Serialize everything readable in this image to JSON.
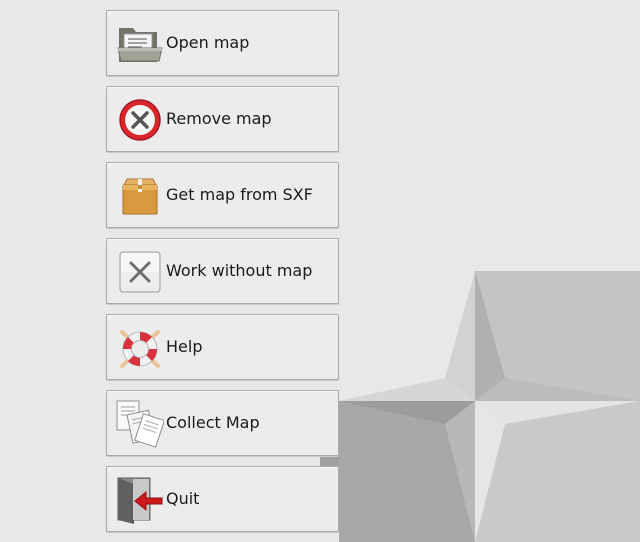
{
  "menu": {
    "items": [
      {
        "label": "Open map",
        "icon": "folder-open-icon"
      },
      {
        "label": "Remove map",
        "icon": "remove-circle-icon"
      },
      {
        "label": "Get map from SXF",
        "icon": "package-box-icon"
      },
      {
        "label": "Work without map",
        "icon": "cross-square-icon"
      },
      {
        "label": "Help",
        "icon": "lifebuoy-icon"
      },
      {
        "label": "Collect Map",
        "icon": "documents-stack-icon"
      },
      {
        "label": "Quit",
        "icon": "exit-door-icon"
      }
    ]
  },
  "colors": {
    "background": "#e8e8e8",
    "button_face": "#ececec",
    "button_border": "#a9a9a9",
    "remove_red": "#d9262c",
    "quit_red": "#cc1a1a"
  }
}
